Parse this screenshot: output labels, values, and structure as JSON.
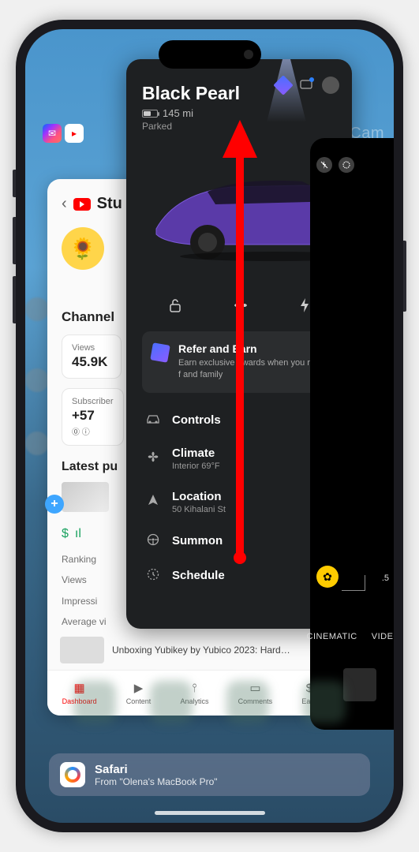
{
  "camera_label": "Cam",
  "youtube": {
    "studio_label": "Stu",
    "channel_label": "Channel",
    "views_label": "Views",
    "views_value": "45.9K",
    "subs_label": "Subscriber",
    "subs_value": "+57",
    "subs_icons": "⓪ ⓘ",
    "latest_label": "Latest pu",
    "metrics": {
      "ranking": "Ranking",
      "views": "Views",
      "impressions": "Impressi",
      "avg": "Average vi"
    },
    "unboxing": "Unboxing Yubikey by Yubico 2023: Hard…",
    "nav": {
      "dashboard": "Dashboard",
      "content": "Content",
      "analytics": "Analytics",
      "comments": "Comments",
      "earn": "Earn"
    },
    "currency": "$"
  },
  "tesla": {
    "name": "Black Pearl",
    "range": "145 mi",
    "status": "Parked",
    "refer_title": "Refer and Earn",
    "refer_sub": "Earn exclusive awards when you refer f\nand family",
    "menu": {
      "controls": "Controls",
      "climate": "Climate",
      "climate_sub": "Interior 69°F",
      "location": "Location",
      "location_sub": "50 Kihalani St",
      "summon": "Summon",
      "schedule": "Schedule"
    }
  },
  "camera": {
    "zoom": ".5",
    "mode_cinematic": "CINEMATIC",
    "mode_video": "VIDEO"
  },
  "handoff": {
    "title": "Safari",
    "sub": "From \"Olena's MacBook Pro\""
  }
}
